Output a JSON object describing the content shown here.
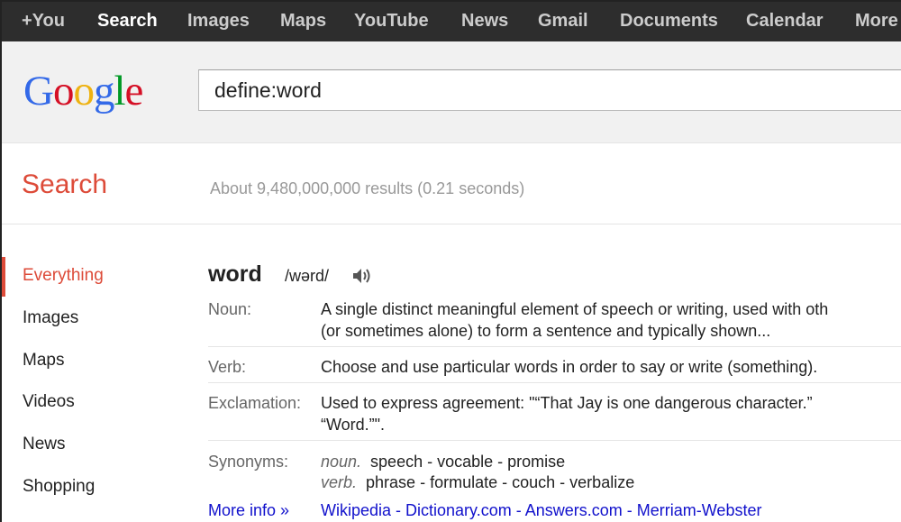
{
  "topnav": {
    "items": [
      {
        "label": "+You",
        "active": false
      },
      {
        "label": "Search",
        "active": true
      },
      {
        "label": "Images",
        "active": false
      },
      {
        "label": "Maps",
        "active": false
      },
      {
        "label": "YouTube",
        "active": false
      },
      {
        "label": "News",
        "active": false
      },
      {
        "label": "Gmail",
        "active": false
      },
      {
        "label": "Documents",
        "active": false
      },
      {
        "label": "Calendar",
        "active": false
      },
      {
        "label": "More",
        "active": false
      }
    ]
  },
  "logo": {
    "letters": [
      "G",
      "o",
      "o",
      "g",
      "l",
      "e"
    ],
    "colors": [
      "#3369e8",
      "#d50f25",
      "#eeb211",
      "#3369e8",
      "#009925",
      "#d50f25"
    ]
  },
  "search": {
    "query": "define:word"
  },
  "results": {
    "title": "Search",
    "stats": "About 9,480,000,000 results (0.21 seconds)"
  },
  "sidebar": {
    "items": [
      {
        "label": "Everything",
        "active": true
      },
      {
        "label": "Images",
        "active": false
      },
      {
        "label": "Maps",
        "active": false
      },
      {
        "label": "Videos",
        "active": false
      },
      {
        "label": "News",
        "active": false
      },
      {
        "label": "Shopping",
        "active": false
      }
    ]
  },
  "definition": {
    "word": "word",
    "pronunciation": "/wərd/",
    "speaker_icon": "speaker-icon",
    "noun_label": "Noun:",
    "noun_line1": "A single distinct meaningful element of speech or writing, used with oth",
    "noun_line2": "(or sometimes alone) to form a sentence and typically shown...",
    "verb_label": "Verb:",
    "verb_text": "Choose and use particular words in order to say or write (something).",
    "excl_label": "Exclamation:",
    "excl_line1": "Used to express agreement: \"“That Jay is one dangerous character.”",
    "excl_line2": "“Word.”\".",
    "syn_label": "Synonyms:",
    "syn_noun_pos": "noun.",
    "syn_noun": [
      "speech",
      "vocable",
      "promise"
    ],
    "syn_verb_pos": "verb.",
    "syn_verb": [
      "phrase",
      "formulate",
      "couch",
      "verbalize"
    ],
    "more_info": "More info »",
    "sources": [
      "Wikipedia",
      "Dictionary.com",
      "Answers.com",
      "Merriam-Webster"
    ],
    "separator": " - "
  },
  "colors": {
    "accent": "#dd4b39",
    "link": "#1111cc",
    "topbar": "#2d2d2d"
  }
}
